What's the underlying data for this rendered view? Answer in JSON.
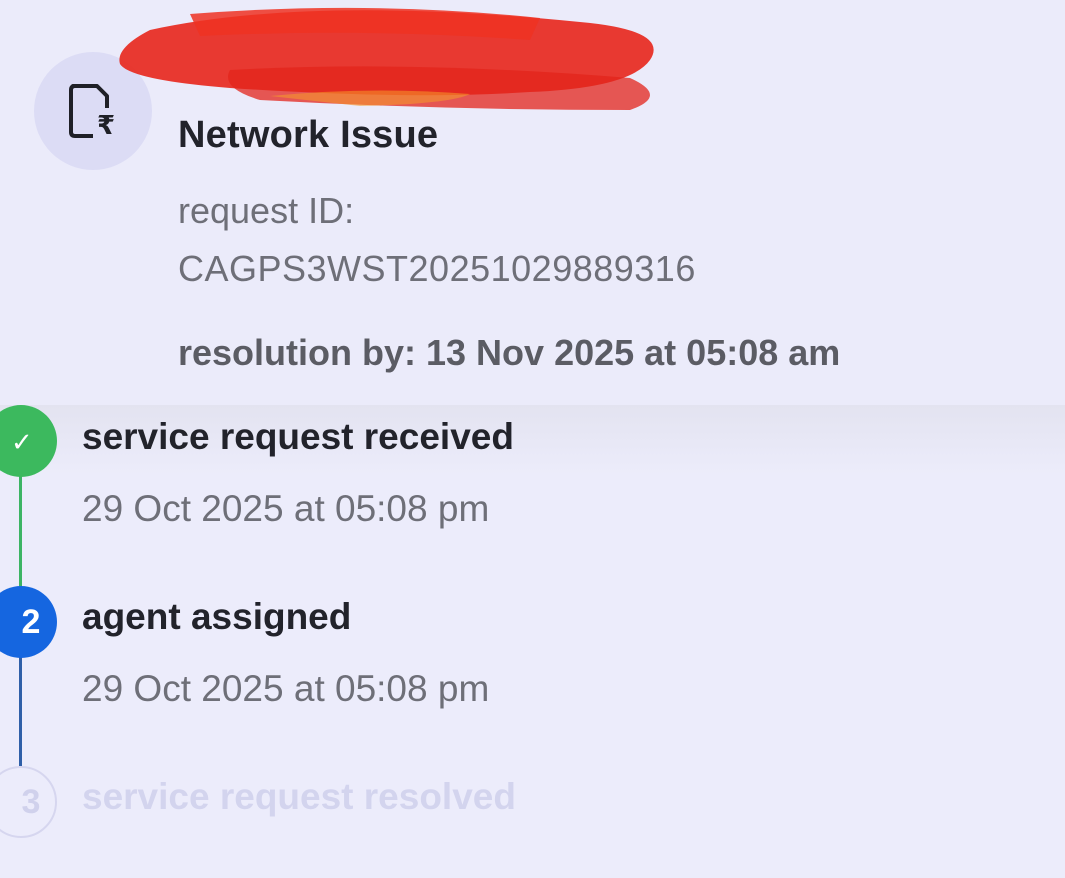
{
  "header": {
    "issue_title": "Network Issue",
    "request_id_label": "request ID:",
    "request_id": "CAGPS3WST20251029889316",
    "resolution_label": "resolution by:",
    "resolution_value": "13 Nov 2025 at 05:08 am",
    "icon": "document-rupee-icon"
  },
  "timeline": {
    "steps": [
      {
        "marker": "✓",
        "title": "service request received",
        "date": "29 Oct 2025 at 05:08 pm",
        "status": "completed",
        "color": "#3cb95e"
      },
      {
        "marker": "2",
        "title": "agent assigned",
        "date": "29 Oct 2025 at 05:08 pm",
        "status": "current",
        "color": "#1566e0"
      },
      {
        "marker": "3",
        "title": "service request resolved",
        "status": "pending",
        "color": "#d3d4ee"
      }
    ]
  }
}
